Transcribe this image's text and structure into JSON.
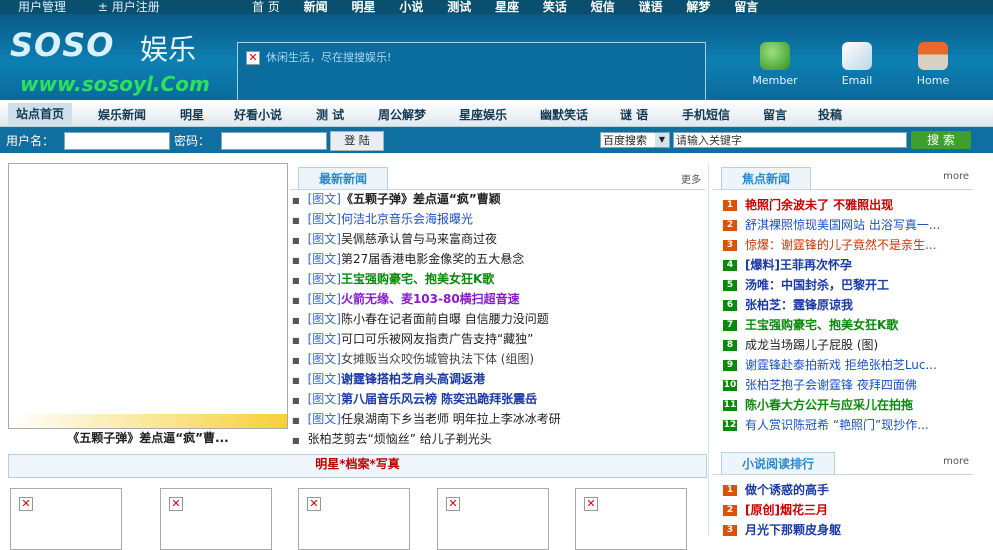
{
  "topbar": {
    "user_manage": "用户管理",
    "user_register": "± 用户注册",
    "nav": [
      "首 页",
      "新闻",
      "明星",
      "小说",
      "测试",
      "星座",
      "笑话",
      "短信",
      "谜语",
      "解梦",
      "留言"
    ]
  },
  "header": {
    "logo_text": "SOSO",
    "logo_yule": "娱乐",
    "logo_url": "www.sosoyl.Com",
    "search_tip": "休闲生活，尽在搜搜娱乐!",
    "icons": [
      {
        "label": "Member",
        "icon": "member-icon"
      },
      {
        "label": "Email",
        "icon": "email-icon"
      },
      {
        "label": "Home",
        "icon": "home-icon"
      }
    ]
  },
  "menu": [
    "站点首页",
    "娱乐新闻",
    "明星",
    "好看小说",
    "测 试",
    "周公解梦",
    "星座娱乐",
    "幽默笑话",
    "谜 语",
    "手机短信",
    "留言",
    "投稿"
  ],
  "login": {
    "username_label": "用户名：",
    "password_label": "密码：",
    "login_button": "登 陆",
    "engine": "百度搜索",
    "keyword_placeholder": "请输入关键字",
    "search_button": "搜 索"
  },
  "photo_caption": "《五颗子弹》差点逼“疯”曹...",
  "latest": {
    "title": "最新新闻",
    "more": "更多",
    "items": [
      {
        "tag": "[图文]",
        "text": "《五颗子弹》差点逼“疯”曹颖",
        "color": "#222222",
        "bold": true
      },
      {
        "tag": "[图文]",
        "text": "何洁北京音乐会海报曝光",
        "color": "#1a50c8",
        "bold": false
      },
      {
        "tag": "[图文]",
        "text": "吴佩慈承认曾与马来富商过夜",
        "color": "#222222",
        "bold": false
      },
      {
        "tag": "[图文]",
        "text": "第27届香港电影金像奖的五大悬念",
        "color": "#222222",
        "bold": false
      },
      {
        "tag": "[图文]",
        "text": "王宝强购豪宅、抱美女狂K歌",
        "color": "#0a8a0a",
        "bold": true
      },
      {
        "tag": "[图文]",
        "text": "火箭无缘、麦103-80横扫超音速",
        "color": "#8a1ad0",
        "bold": true
      },
      {
        "tag": "[图文]",
        "text": "陈小春在记者面前自曝 自信腰力没问题",
        "color": "#222222",
        "bold": false
      },
      {
        "tag": "[图文]",
        "text": "可口可乐被网友指责广告支持“藏独”",
        "color": "#222222",
        "bold": false
      },
      {
        "tag": "[图文]",
        "text": "女摊贩当众咬伤城管执法下体 (组图)",
        "color": "#444444",
        "bold": false
      },
      {
        "tag": "[图文]",
        "text": "谢霆锋搭柏芝肩头高调返港",
        "color": "#1a3aa8",
        "bold": true
      },
      {
        "tag": "[图文]",
        "text": "第八届音乐风云榜 陈奕迅跪拜张震岳",
        "color": "#1a3aa8",
        "bold": true
      },
      {
        "tag": "[图文]",
        "text": "任泉湖南下乡当老师 明年拉上李冰冰考研",
        "color": "#222222",
        "bold": false
      },
      {
        "tag": "",
        "text": "张柏芝剪去“烦恼丝” 给儿子剃光头",
        "color": "#222222",
        "bold": false
      }
    ]
  },
  "focus": {
    "title": "焦点新闻",
    "more": "more",
    "items": [
      {
        "num": "1",
        "text": "艳照门余波未了 不雅照出现",
        "color": "#cc0000",
        "bold": true,
        "numc": "#e05000"
      },
      {
        "num": "2",
        "text": "舒淇裸照惊现美国网站 出浴写真一...",
        "color": "#1a50c8",
        "bold": false,
        "numc": "#e05000"
      },
      {
        "num": "3",
        "text": "惊爆：谢霆锋的儿子竟然不是亲生...",
        "color": "#cc3300",
        "bold": false,
        "numc": "#e05000"
      },
      {
        "num": "4",
        "text": "[爆料]王菲再次怀孕",
        "color": "#1a3aa8",
        "bold": true,
        "numc": "#0a8a0a"
      },
      {
        "num": "5",
        "text": "汤唯：中国封杀，巴黎开工",
        "color": "#1a3aa8",
        "bold": true,
        "numc": "#0a8a0a"
      },
      {
        "num": "6",
        "text": "张柏芝：霆锋原谅我",
        "color": "#1a3aa8",
        "bold": true,
        "numc": "#0a8a0a"
      },
      {
        "num": "7",
        "text": "王宝强购豪宅、抱美女狂K歌",
        "color": "#0a8a0a",
        "bold": true,
        "numc": "#0a8a0a"
      },
      {
        "num": "8",
        "text": "成龙当场踢儿子屁股 (图)",
        "color": "#222222",
        "bold": false,
        "numc": "#0a8a0a"
      },
      {
        "num": "9",
        "text": "谢霆锋赴泰拍新戏 拒绝张柏芝Luc...",
        "color": "#1a50c8",
        "bold": false,
        "numc": "#0a8a0a"
      },
      {
        "num": "10",
        "text": "张柏芝抱子会谢霆锋 夜拜四面佛",
        "color": "#1a50c8",
        "bold": false,
        "numc": "#0a8a0a"
      },
      {
        "num": "11",
        "text": "陈小春大方公开与应采儿在拍拖",
        "color": "#0a8a0a",
        "bold": true,
        "numc": "#0a8a0a"
      },
      {
        "num": "12",
        "text": "有人赏识陈冠希 “艳照门”现抄作...",
        "color": "#1a50c8",
        "bold": false,
        "numc": "#0a8a0a"
      }
    ]
  },
  "novel": {
    "title": "小说阅读排行",
    "more": "more",
    "items": [
      {
        "num": "1",
        "text": "做个诱惑的高手",
        "color": "#1a3aa8",
        "bold": true,
        "numc": "#e05000"
      },
      {
        "num": "2",
        "text": "[原创]烟花三月",
        "color": "#cc0000",
        "bold": true,
        "numc": "#e05000"
      },
      {
        "num": "3",
        "text": "月光下那颗皮身躯",
        "color": "#1a3aa8",
        "bold": true,
        "numc": "#e05000"
      }
    ]
  },
  "star_bar": "明星*档案*写真"
}
